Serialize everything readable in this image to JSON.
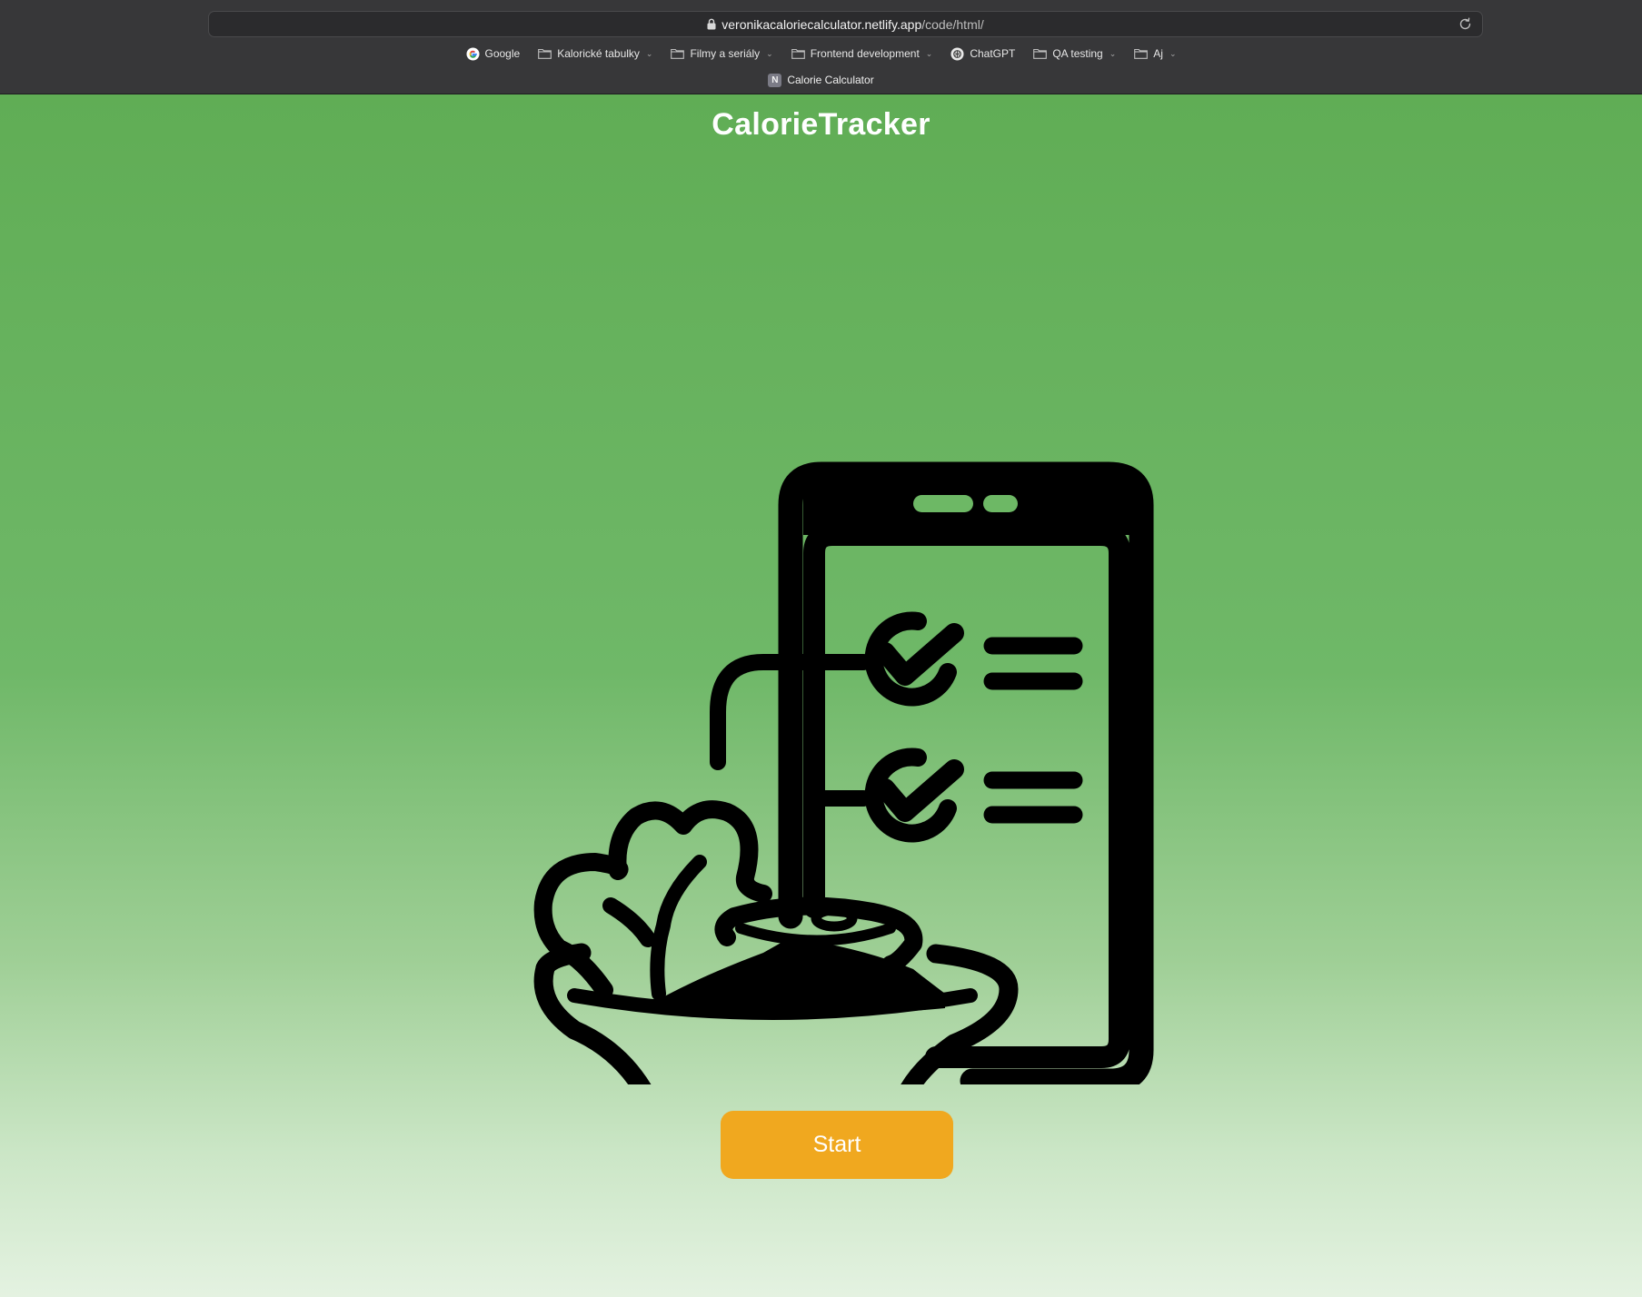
{
  "browser": {
    "url_host": "veronikacaloriecalculator.netlify.app",
    "url_path": "/code/html/",
    "bookmarks": [
      {
        "label": "Google",
        "icon": "google-icon",
        "dropdown": false
      },
      {
        "label": "Kalorické tabulky",
        "icon": "folder-icon",
        "dropdown": true
      },
      {
        "label": "Filmy a seriály",
        "icon": "folder-icon",
        "dropdown": true
      },
      {
        "label": "Frontend development",
        "icon": "folder-icon",
        "dropdown": true
      },
      {
        "label": "ChatGPT",
        "icon": "chatgpt-icon",
        "dropdown": false
      },
      {
        "label": "QA testing",
        "icon": "folder-icon",
        "dropdown": true
      },
      {
        "label": "Aj",
        "icon": "folder-icon",
        "dropdown": true
      }
    ],
    "tab": {
      "title": "Calorie Calculator",
      "favicon_letter": "N"
    }
  },
  "page": {
    "title": "CalorieTracker",
    "hero_icon": "phone-checklist-salad-icon",
    "start_label": "Start"
  },
  "colors": {
    "green_top": "#60ad55",
    "green_bottom": "#e4f2e1",
    "start_button": "#f0a81f",
    "icon_stroke": "#000000"
  }
}
